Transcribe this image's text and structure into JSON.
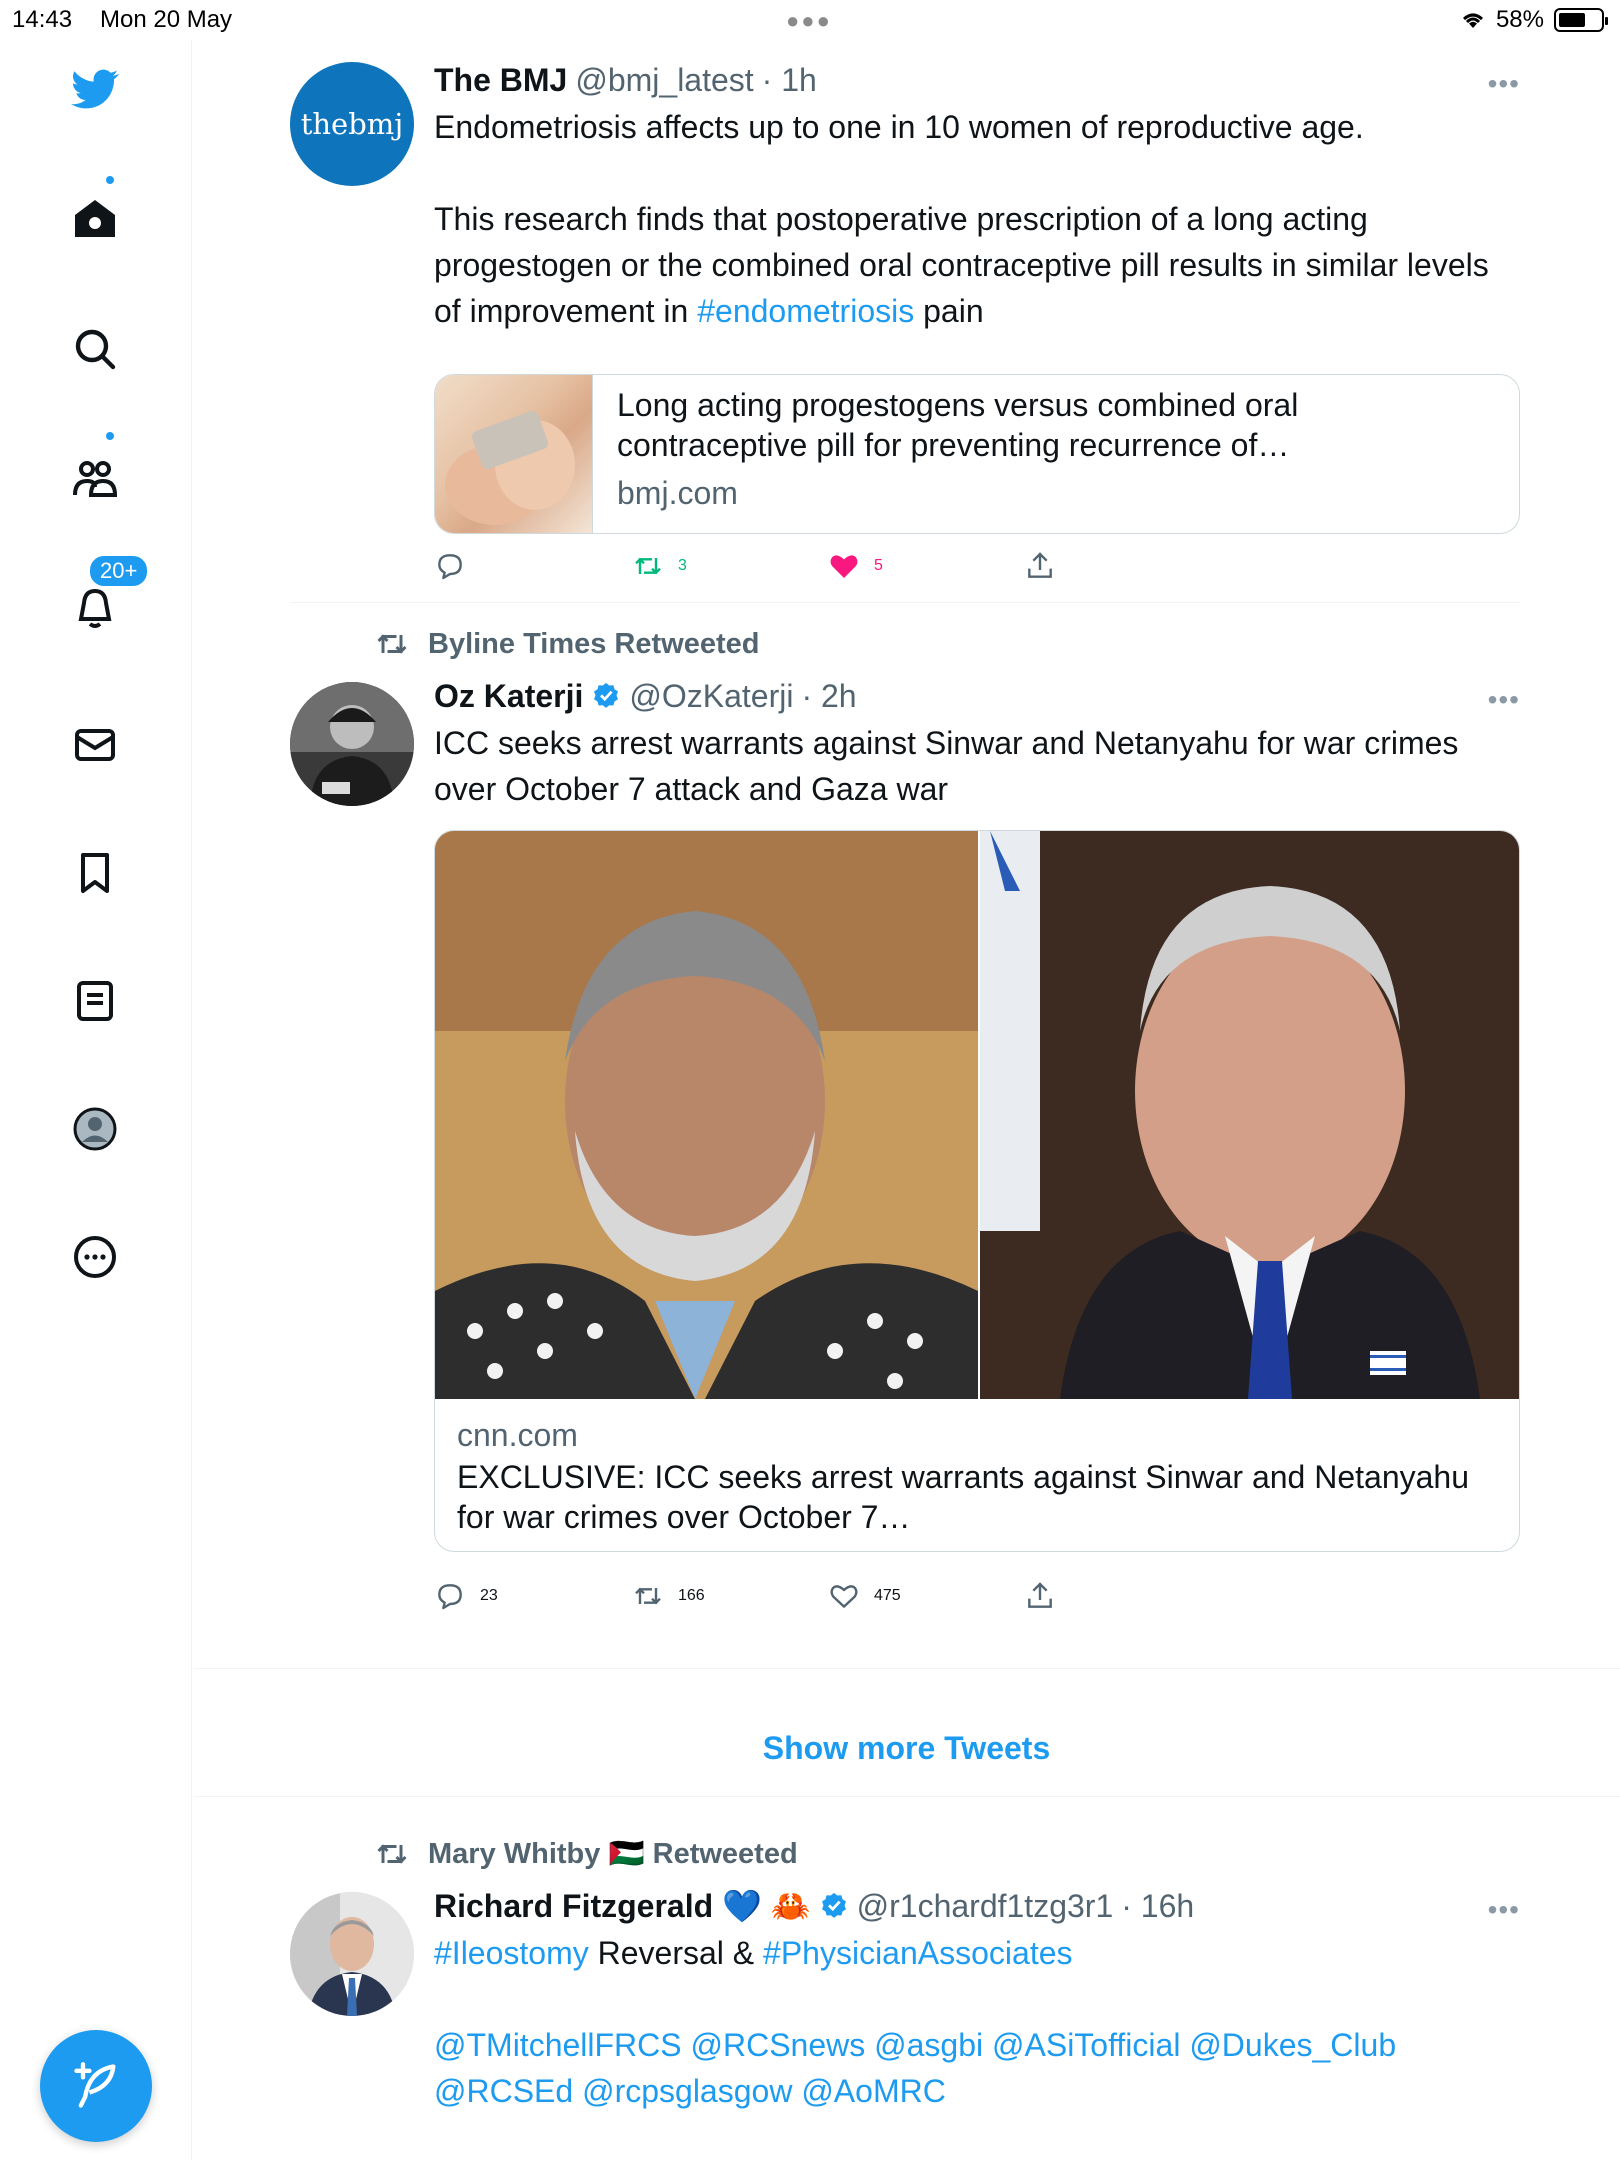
{
  "status_bar": {
    "time": "14:43",
    "date": "Mon 20 May",
    "battery": "58%"
  },
  "sidebar": {
    "notification_count": "20+"
  },
  "tweets": [
    {
      "avatar_text": "thebmj",
      "name": "The BMJ",
      "handle": "@bmj_latest",
      "time": "· 1h",
      "text_p1": "Endometriosis affects up to one in 10 women of reproductive age.",
      "text_p2_before": "This research finds that postoperative prescription of a long acting progestogen or the combined oral contraceptive pill results in similar levels of improvement in ",
      "hashtag": "#endometriosis",
      "text_p2_after": " pain",
      "card": {
        "title": "Long acting progestogens versus combined oral contraceptive pill for preventing recurrence of…",
        "domain": "bmj.com"
      },
      "replies": "",
      "retweets": "3",
      "likes": "5"
    },
    {
      "retweeted_by": "Byline Times Retweeted",
      "name": "Oz Katerji",
      "handle": "@OzKaterji",
      "time": "· 2h",
      "text": "ICC seeks arrest warrants against Sinwar and Netanyahu for war crimes over October 7 attack and Gaza war",
      "card": {
        "domain": "cnn.com",
        "title": "EXCLUSIVE: ICC seeks arrest warrants against Sinwar and Netanyahu for war crimes over October 7…"
      },
      "replies": "23",
      "retweets": "166",
      "likes": "475"
    },
    {
      "retweeted_by": "Mary Whitby 🇵🇸 Retweeted",
      "name": "Richard Fitzgerald 💙 🦀",
      "handle": "@r1chardf1tzg3r1",
      "time": "· 16h",
      "hashtag1": "#Ileostomy",
      "text_mid": " Reversal & ",
      "hashtag2": "#PhysicianAssociates",
      "mentions_line1": "@TMitchellFRCS @RCSnews @asgbi @ASiTofficial @Dukes_Club",
      "mentions_line2": "@RCSEd @rcpsglasgow @AoMRC"
    }
  ],
  "show_more": "Show more Tweets",
  "colors": {
    "accent": "#1d9bf0",
    "retweet_green": "#00ba7c",
    "like_pink": "#f91880",
    "secondary": "#536471"
  }
}
